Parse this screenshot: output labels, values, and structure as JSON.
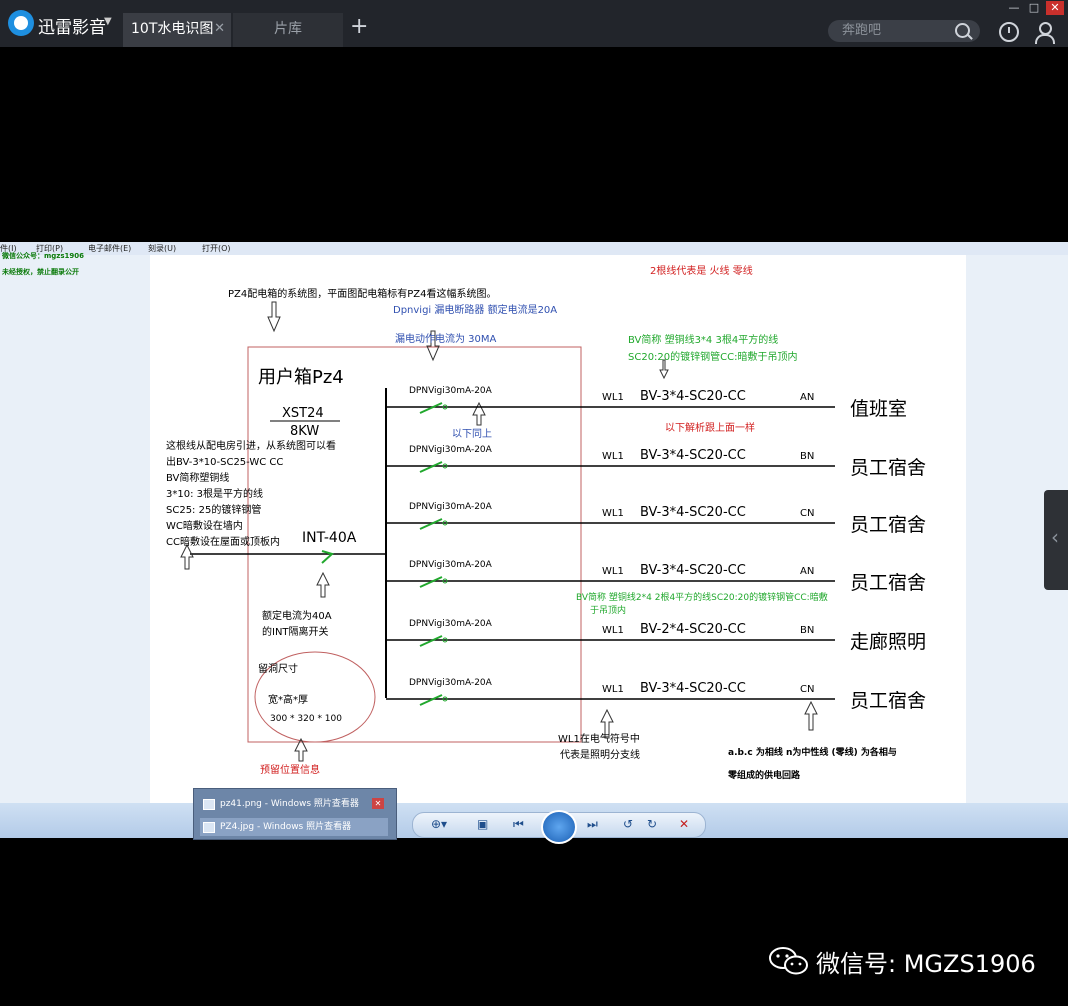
{
  "app": {
    "brand": "迅雷影音",
    "tabs": [
      {
        "label": "10T水电识图",
        "active": true
      },
      {
        "label": "片库",
        "active": false
      }
    ],
    "search_placeholder": "奔跑吧"
  },
  "viewer_menu": {
    "items": [
      "件(I)",
      "打印(P)",
      "电子邮件(E)",
      "刻录(U)",
      "打开(O)"
    ]
  },
  "left_pane": {
    "line1": "微信公众号：mgzs1906",
    "line2": "未经授权，禁止翻录公开"
  },
  "drawing": {
    "top_note": "2根线代表是 火线 零线",
    "title": "PZ4配电箱的系统图，平面图配电箱标有PZ4看这幅系统图。",
    "rcd_note": "Dpnvigi 漏电断路器 额定电流是20A",
    "leakage_note": "漏电动作电流为 30MA",
    "bv_note_line1": "BV简称 塑铜线3*4 3根4平方的线",
    "bv_note_line2": "SC20:20的镀锌钢管CC:暗敷于吊顶内",
    "box_label": "用户箱Pz4",
    "box_model": "XST24",
    "box_power": "8KW",
    "same_below": "以下同上",
    "parse_same": "以下解析跟上面一样",
    "incoming_notes": [
      "这根线从配电房引进，从系统图可以看",
      "出BV-3*10-SC25-WC CC",
      "BV简称塑铜线",
      "3*10: 3根是平方的线",
      "SC25: 25的镀锌钢管",
      "WC暗敷设在墙内",
      "CC暗敷设在屋面或顶板内"
    ],
    "main_switch": "INT-40A",
    "switch_note_line1": "额定电流为40A",
    "switch_note_line2": "的INT隔离开关",
    "reserve_label": "留洞尺寸",
    "reserve_dims": "宽*高*厚",
    "reserve_values": "300 * 320 * 100",
    "reserve_note": "预留位置信息",
    "bv_note2_line1": "BV简称 塑铜线2*4 2根4平方的线SC20:20的镀锌钢管CC:暗敷",
    "bv_note2_line2": "于吊顶内",
    "wl_note_line1": "WL1在电气符号中",
    "wl_note_line2": "代表是照明分支线",
    "phase_note_line1": "a.b.c 为相线 n为中性线 (零线) 为各相与",
    "phase_note_line2": "零组成的供电回路",
    "circuits": [
      {
        "breaker": "DPNVigi30mA-20A",
        "wl": "WL1",
        "cable": "BV-3*4-SC20-CC",
        "phase": "AN",
        "room": "值班室"
      },
      {
        "breaker": "DPNVigi30mA-20A",
        "wl": "WL1",
        "cable": "BV-3*4-SC20-CC",
        "phase": "BN",
        "room": "员工宿舍"
      },
      {
        "breaker": "DPNVigi30mA-20A",
        "wl": "WL1",
        "cable": "BV-3*4-SC20-CC",
        "phase": "CN",
        "room": "员工宿舍"
      },
      {
        "breaker": "DPNVigi30mA-20A",
        "wl": "WL1",
        "cable": "BV-3*4-SC20-CC",
        "phase": "AN",
        "room": "员工宿舍"
      },
      {
        "breaker": "DPNVigi30mA-20A",
        "wl": "WL1",
        "cable": "BV-2*4-SC20-CC",
        "phase": "BN",
        "room": "走廊照明"
      },
      {
        "breaker": "DPNVigi30mA-20A",
        "wl": "WL1",
        "cable": "BV-3*4-SC20-CC",
        "phase": "CN",
        "room": "员工宿舍"
      }
    ]
  },
  "taskbar": {
    "items": [
      "pz41.png - Windows 照片查看器",
      "PZ4.jpg - Windows 照片查看器"
    ]
  },
  "watermark": "微信号: MGZS1906",
  "colors": {
    "title_bar": "#22252b",
    "note_red": "#d22020",
    "note_green": "#21a82d",
    "note_blue": "#3050b0",
    "line": "#000000"
  }
}
